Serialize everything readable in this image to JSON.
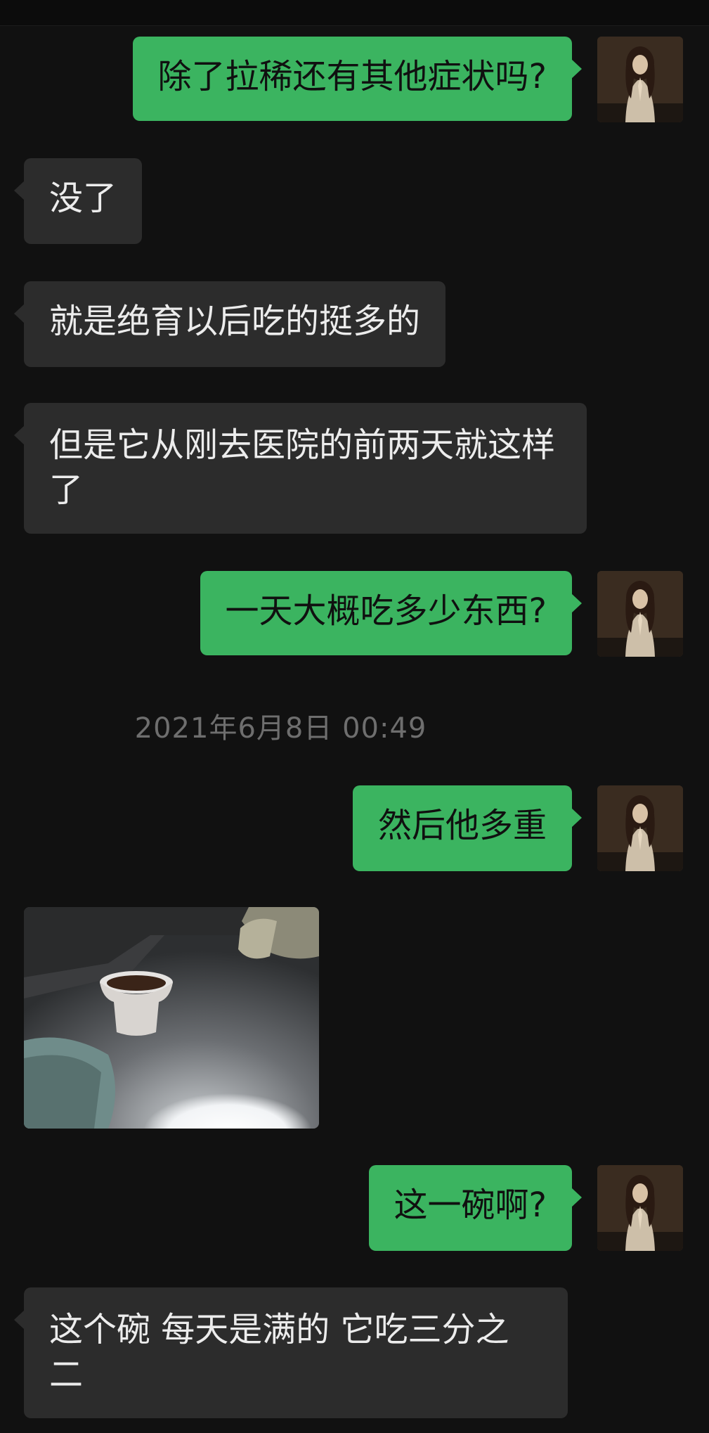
{
  "messages": [
    {
      "side": "out",
      "text": "除了拉稀还有其他症状吗?"
    },
    {
      "side": "in",
      "text": "没了"
    },
    {
      "side": "in",
      "text": "就是绝育以后吃的挺多的"
    },
    {
      "side": "in",
      "text": "但是它从刚去医院的前两天就这样了"
    },
    {
      "side": "out",
      "text": "一天大概吃多少东西?"
    },
    {
      "side": "out",
      "text": "然后他多重"
    },
    {
      "side": "out",
      "text": "这一碗啊?"
    },
    {
      "side": "in",
      "text": "这个碗 每天是满的 它吃三分之二"
    }
  ],
  "timestamp": "2021年6月8日 00:49",
  "colors": {
    "background": "#111111",
    "outgoing_bubble": "#3bb460",
    "incoming_bubble": "#2c2c2c",
    "timestamp_text": "#6e6e6e"
  },
  "icons": {
    "avatar": "avatar-woman-portrait",
    "photo": "photo-cat-food-bowl"
  }
}
